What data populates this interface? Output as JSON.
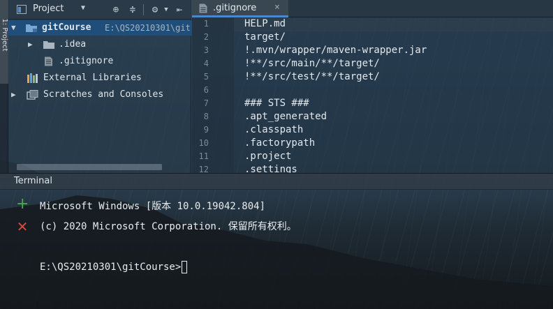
{
  "tool_stripe": {
    "label": "1: Project"
  },
  "project_panel": {
    "title": "Project",
    "tree": [
      {
        "label": "gitCourse",
        "path": "E:\\QS20210301\\git"
      },
      {
        "label": ".idea"
      },
      {
        "label": ".gitignore"
      },
      {
        "label": "External Libraries"
      },
      {
        "label": "Scratches and Consoles"
      }
    ]
  },
  "editor": {
    "tab_label": ".gitignore",
    "close_glyph": "×",
    "line_numbers": [
      "1",
      "2",
      "3",
      "4",
      "5",
      "6",
      "7",
      "8",
      "9",
      "10",
      "11",
      "12"
    ],
    "lines": [
      "HELP.md",
      "target/",
      "!.mvn/wrapper/maven-wrapper.jar",
      "!**/src/main/**/target/",
      "!**/src/test/**/target/",
      "",
      "### STS ###",
      ".apt_generated",
      ".classpath",
      ".factorypath",
      ".project",
      ".settings"
    ]
  },
  "terminal": {
    "title": "Terminal",
    "add_glyph": "+",
    "close_glyph": "✕",
    "lines": [
      "Microsoft Windows [版本 10.0.19042.804]",
      "(c) 2020 Microsoft Corporation. 保留所有权利。",
      "",
      "E:\\QS20210301\\gitCourse>"
    ]
  },
  "colors": {
    "selection": "#1f4e7a",
    "tab_underline": "#4a88c7",
    "add_green": "#4fa84f",
    "close_red": "#d24a3c"
  }
}
